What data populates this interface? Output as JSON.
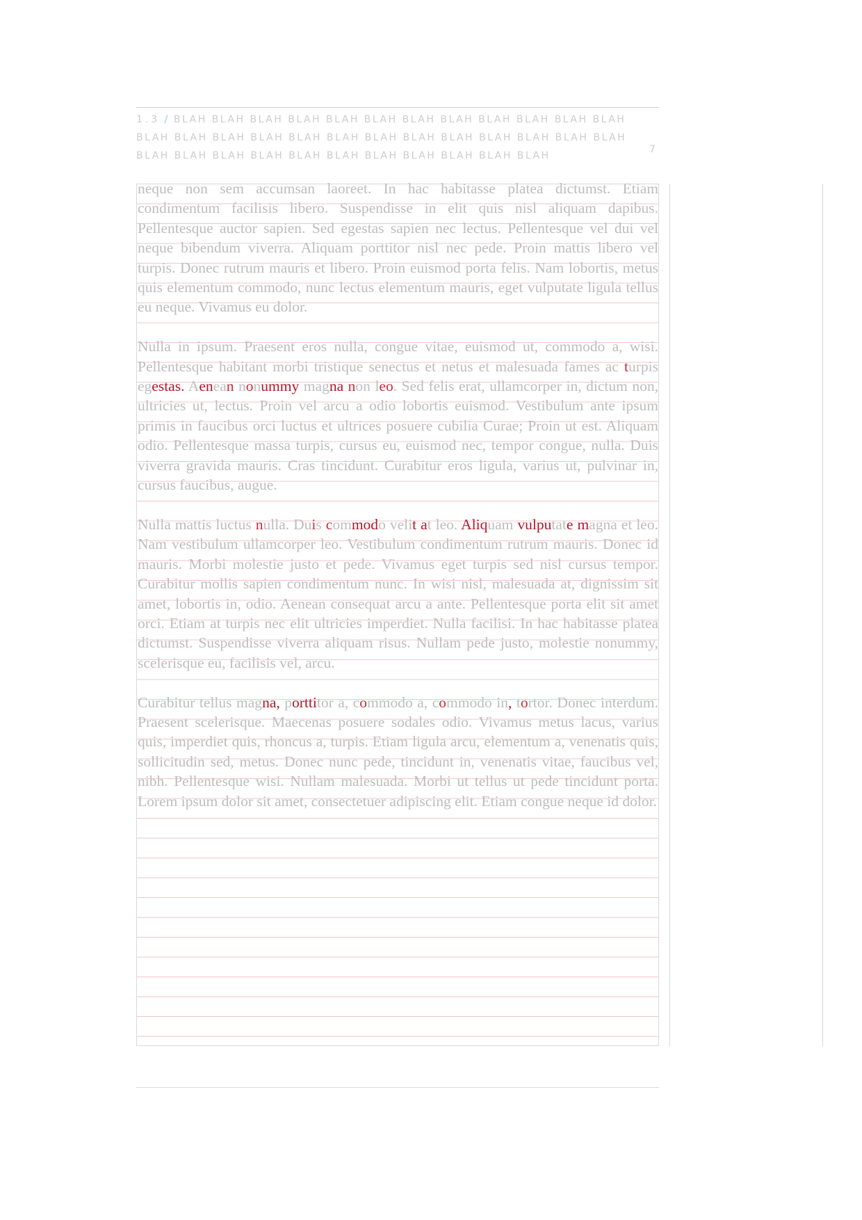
{
  "header": {
    "section_number": "1.3",
    "slash": "/",
    "running_title": "BLAH BLAH BLAH BLAH BLAH BLAH BLAH BLAH BLAH BLAH BLAH BLAH BLAH BLAH BLAH BLAH BLAH BLAH BLAH BLAH BLAH BLAH BLAH BLAH BLAH BLAH BLAH BLAH BLAH BLAH BLAH BLAH BLAH BLAH BLAH BLAH",
    "page_number": "7"
  },
  "body": {
    "p1": "neque non sem accumsan laoreet. In hac habitasse platea dictumst. Etiam condimentum facilisis libero. Suspendisse in elit quis nisl aliquam dapibus. Pellentesque auctor sapien. Sed egestas sapien nec lectus. Pellentesque vel dui vel neque bibendum viverra. Aliquam porttitor nisl nec pede. Proin mattis libero vel turpis. Donec rutrum mauris et libero. Proin euismod porta felis. Nam lobortis, metus quis elementum commodo, nunc lectus elementum mauris, eget vulputate ligula tellus eu neque. Vivamus eu dolor.",
    "p2": {
      "s1": "Nulla in ipsum. Praesent eros nulla, congue vitae, euismod ut, commodo a, wisi. Pellentesque habitant morbi tristique senectus et netus et malesuada fames ac ",
      "h1": "t",
      "s2": "urpis eg",
      "h2": "estas.",
      "s3": " A",
      "h3": "en",
      "s4": "ea",
      "h4": "n",
      "s5": " n",
      "h5": "o",
      "s6": "n",
      "h6": "ummy",
      "s7": " mag",
      "h7": "na",
      "s8": " ",
      "h8": "n",
      "s9": "on l",
      "h9": "eo",
      "s10": ". Sed felis erat, ullamcorper in, dictum non, ultricies ut, lectus. Proin vel arcu a odio lobortis euismod. Vestibulum ante ipsum primis in faucibus orci luctus et ultrices posuere cubilia Curae; Proin ut est. Aliquam odio. Pellentesque massa turpis, cursus eu, euismod nec, tempor congue, nulla. Duis viverra gravida mauris. Cras tincidunt. Curabitur eros ligula, varius ut, pulvinar in, cursus faucibus, augue."
    },
    "p3": {
      "s1": "Nulla mattis luctus ",
      "h1": "n",
      "s2": "ulla. Du",
      "h2": "i",
      "s3": "s ",
      "h3": "c",
      "s4": "om",
      "h4": "mod",
      "s5": "o veli",
      "h5": "t a",
      "s6": "t leo. ",
      "h6": "Aliq",
      "s7": "uam ",
      "h7": "vulpu",
      "s8": "tat",
      "h8": "e m",
      "s9": "agna et leo. Nam vestibulum ullamcorper leo. Vestibulum condimentum rutrum mauris. Donec id mauris. Morbi molestie justo et pede. Vivamus eget turpis sed nisl cursus tempor. Curabitur mollis sapien condimentum nunc. In wisi nisl, malesuada at, dignissim sit amet, lobortis in, odio. Aenean consequat arcu a ante. Pellentesque porta elit sit amet orci. Etiam at turpis nec elit ultricies imperdiet. Nulla facilisi. In hac habitasse platea dictumst. Suspendisse viverra aliquam risus. Nullam pede justo, molestie nonummy, scelerisque eu, facilisis vel, arcu."
    },
    "p4": {
      "s1": "Curabitur tellus mag",
      "h1": "na,",
      "s2": " p",
      "h2": "ortti",
      "s3": "tor a, c",
      "h3": "o",
      "s4": "mmodo a, c",
      "h4": "o",
      "s5": "mmodo in",
      "h5": ",",
      "s6": " t",
      "h6": "o",
      "s7": "rtor. Donec interdum. Praesent scelerisque. Maecenas posuere sodales odio. Vivamus metus lacus, varius quis, imperdiet quis, rhoncus a, turpis. Etiam ligula arcu, elementum a, venenatis quis, sollicitudin sed, metus. Donec nunc pede, tincidunt in, venenatis vitae, faucibus vel, nibh. Pellentesque wisi. Nullam malesuada. Morbi ut tellus ut pede tincidunt porta. Lorem ipsum dolor sit amet, consectetuer adipiscing elit. Etiam congue neque id dolor."
    }
  },
  "colors": {
    "body_text": "#bdbdbd",
    "highlight": "#d2293a",
    "baseline_grid": "#f2c6cc",
    "header_slash": "#a9d7e6",
    "frame_border": "#d9d9d9"
  }
}
